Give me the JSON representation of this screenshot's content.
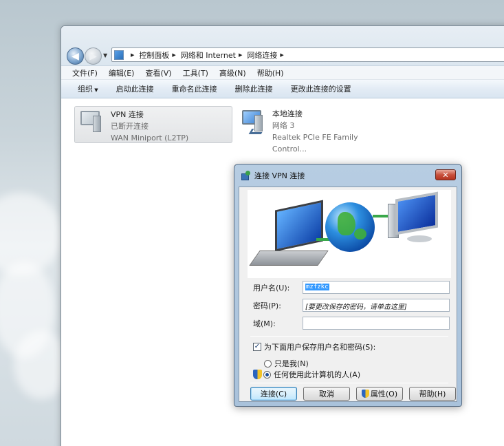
{
  "explorer": {
    "address": {
      "breadcrumbs": [
        "控制面板",
        "网络和 Internet",
        "网络连接"
      ]
    },
    "menu": [
      "文件(F)",
      "编辑(E)",
      "查看(V)",
      "工具(T)",
      "高级(N)",
      "帮助(H)"
    ],
    "commands": {
      "organize": "组织",
      "start": "启动此连接",
      "rename": "重命名此连接",
      "delete": "删除此连接",
      "settings": "更改此连接的设置"
    },
    "connections": [
      {
        "name": "VPN 连接",
        "status": "已断开连接",
        "device": "WAN Miniport (L2TP)",
        "icon": "vpn-connection-icon"
      },
      {
        "name": "本地连接",
        "status": "网络 3",
        "device": "Realtek PCIe FE Family Control...",
        "icon": "network-connection-icon"
      }
    ]
  },
  "dialog": {
    "title": "连接 VPN 连接",
    "close_label": "✕",
    "username_label": "用户名(U):",
    "username_value": "mzfzkc",
    "password_label": "密码(P):",
    "password_hint": "[要更改保存的密码，请单击这里]",
    "domain_label": "域(M):",
    "domain_value": "",
    "save_checkbox_label": "为下面用户保存用户名和密码(S):",
    "save_checked": true,
    "radio_me_label": "只是我(N)",
    "radio_anyone_label": "任何使用此计算机的人(A)",
    "buttons": {
      "connect": "连接(C)",
      "cancel": "取消",
      "properties": "属性(O)",
      "help": "帮助(H)"
    }
  }
}
